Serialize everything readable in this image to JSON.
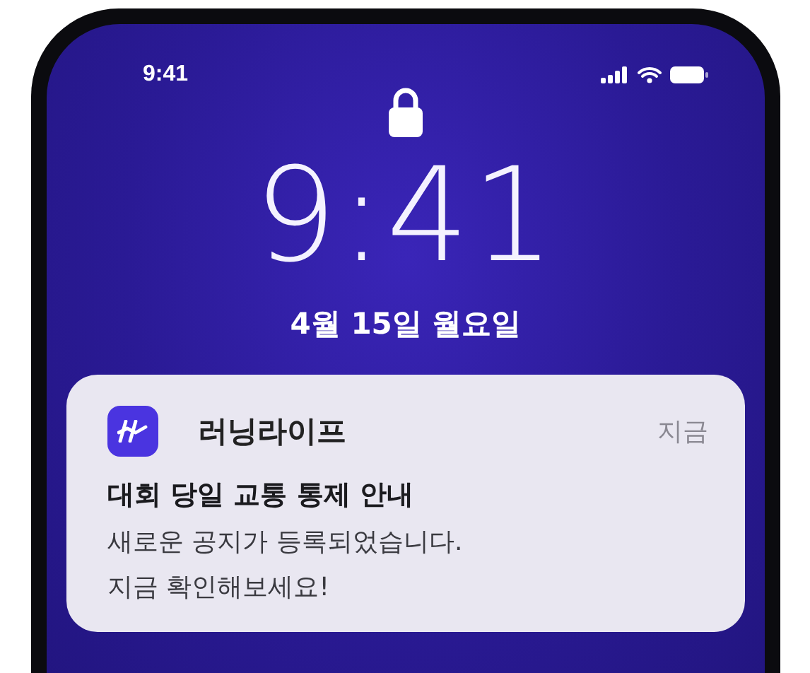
{
  "status_bar": {
    "time": "9:41"
  },
  "lock_screen": {
    "clock": "9:41",
    "date": "4월 15일 월요일"
  },
  "notification": {
    "app_name": "러닝라이프",
    "time": "지금",
    "title": "대회 당일 교통 통제 안내",
    "body_lines": [
      "새로운 공지가 등록되었습니다.",
      "지금 확인해보세요!"
    ]
  }
}
